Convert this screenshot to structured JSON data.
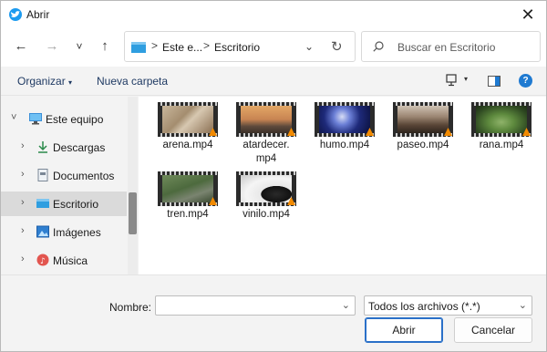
{
  "window": {
    "title": "Abrir",
    "close_glyph": "✕"
  },
  "nav": {
    "back_glyph": "←",
    "forward_glyph": "→",
    "recent_glyph": "˅",
    "up_glyph": "↑",
    "address": {
      "part1": "Este e...",
      "part2": "Escritorio",
      "separator": ">",
      "chevron": "⌄",
      "refresh": "↻"
    },
    "search_placeholder": "Buscar en Escritorio"
  },
  "toolbar": {
    "organize_label": "Organizar",
    "organize_caret": "▾",
    "new_folder_label": "Nueva carpeta",
    "view_caret": "▾",
    "help_label": "?"
  },
  "sidebar": {
    "items": [
      {
        "label": "Este equipo",
        "chevron": "˅",
        "icon": "pc-icon"
      },
      {
        "label": "Descargas",
        "chevron": "›",
        "icon": "download-icon"
      },
      {
        "label": "Documentos",
        "chevron": "›",
        "icon": "document-icon"
      },
      {
        "label": "Escritorio",
        "chevron": "›",
        "icon": "desktop-icon"
      },
      {
        "label": "Imágenes",
        "chevron": "›",
        "icon": "pictures-icon"
      },
      {
        "label": "Música",
        "chevron": "›",
        "icon": "music-icon"
      }
    ]
  },
  "files": [
    {
      "name": "arena.mp4"
    },
    {
      "name": "atardecer.",
      "name2": "mp4"
    },
    {
      "name": "humo.mp4"
    },
    {
      "name": "paseo.mp4"
    },
    {
      "name": "rana.mp4"
    },
    {
      "name": "tren.mp4"
    },
    {
      "name": "vinilo.mp4"
    }
  ],
  "bottom": {
    "name_label": "Nombre:",
    "name_value": "",
    "filter_value": "Todos los archivos (*.*)",
    "dropdown_glyph": "⌄",
    "open_label": "Abrir",
    "cancel_label": "Cancelar"
  },
  "colors": {
    "accent": "#1f7ad1",
    "vlc": "#f28a00",
    "folder": "#2f9ee0"
  }
}
